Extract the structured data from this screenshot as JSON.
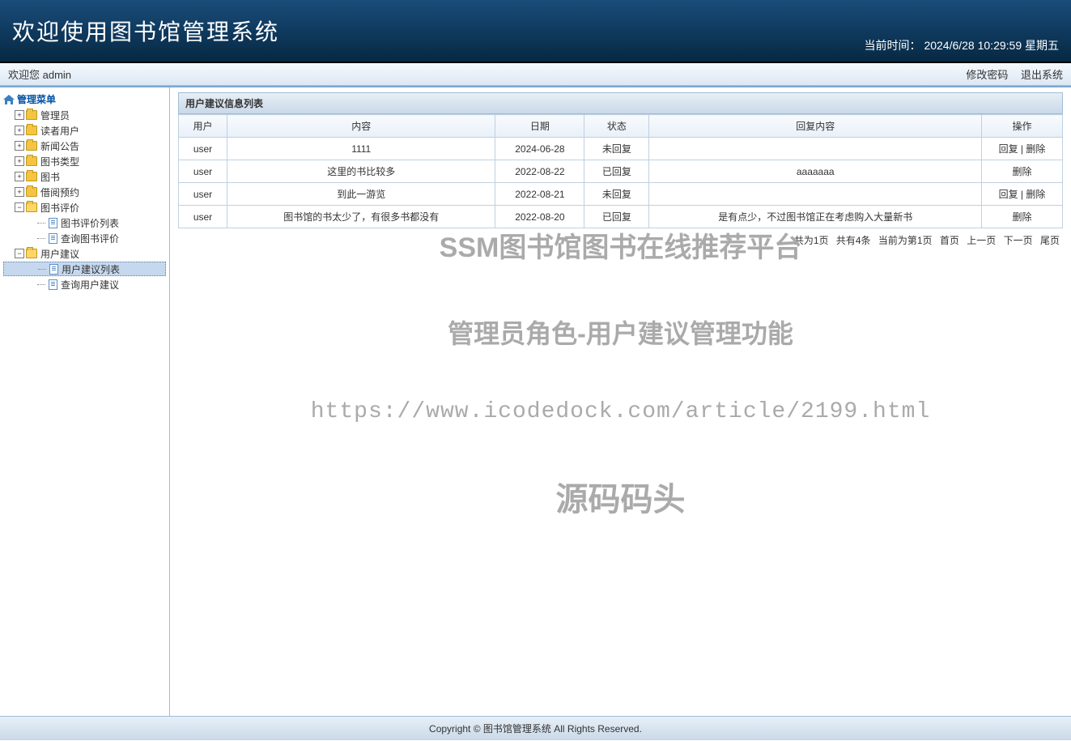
{
  "header": {
    "title": "欢迎使用图书馆管理系统",
    "time_label": "当前时间：",
    "time_value": "2024/6/28 10:29:59 星期五"
  },
  "topbar": {
    "welcome": "欢迎您 admin",
    "change_password": "修改密码",
    "logout": "退出系统"
  },
  "sidebar": {
    "root": "管理菜单",
    "items": [
      {
        "label": "管理员",
        "type": "folder",
        "expanded": false
      },
      {
        "label": "读者用户",
        "type": "folder",
        "expanded": false
      },
      {
        "label": "新闻公告",
        "type": "folder",
        "expanded": false
      },
      {
        "label": "图书类型",
        "type": "folder",
        "expanded": false
      },
      {
        "label": "图书",
        "type": "folder",
        "expanded": false
      },
      {
        "label": "借阅预约",
        "type": "folder",
        "expanded": false
      },
      {
        "label": "图书评价",
        "type": "folder",
        "expanded": true,
        "children": [
          {
            "label": "图书评价列表"
          },
          {
            "label": "查询图书评价"
          }
        ]
      },
      {
        "label": "用户建议",
        "type": "folder",
        "expanded": true,
        "children": [
          {
            "label": "用户建议列表",
            "selected": true
          },
          {
            "label": "查询用户建议"
          }
        ]
      }
    ]
  },
  "panel": {
    "title": "用户建议信息列表"
  },
  "table": {
    "headers": [
      "用户",
      "内容",
      "日期",
      "状态",
      "回复内容",
      "操作"
    ],
    "rows": [
      {
        "user": "user",
        "content": "1111",
        "date": "2024-06-28",
        "status": "未回复",
        "reply": "",
        "ops": [
          "回复",
          "删除"
        ]
      },
      {
        "user": "user",
        "content": "这里的书比较多",
        "date": "2022-08-22",
        "status": "已回复",
        "reply": "aaaaaaa",
        "ops": [
          "删除"
        ]
      },
      {
        "user": "user",
        "content": "到此一游览",
        "date": "2022-08-21",
        "status": "未回复",
        "reply": "",
        "ops": [
          "回复",
          "删除"
        ]
      },
      {
        "user": "user",
        "content": "图书馆的书太少了，有很多书都没有",
        "date": "2022-08-20",
        "status": "已回复",
        "reply": "是有点少，不过图书馆正在考虑购入大量新书",
        "ops": [
          "删除"
        ]
      }
    ]
  },
  "pagination": {
    "total_pages": "共为1页",
    "total_items": "共有4条",
    "current": "当前为第1页",
    "first": "首页",
    "prev": "上一页",
    "next": "下一页",
    "last": "尾页"
  },
  "watermark": {
    "line1": "SSM图书馆图书在线推荐平台",
    "line2": "管理员角色-用户建议管理功能",
    "line3": "https://www.icodedock.com/article/2199.html",
    "line4": "源码码头"
  },
  "footer": {
    "text": "Copyright © 图书馆管理系统 All Rights Reserved."
  }
}
